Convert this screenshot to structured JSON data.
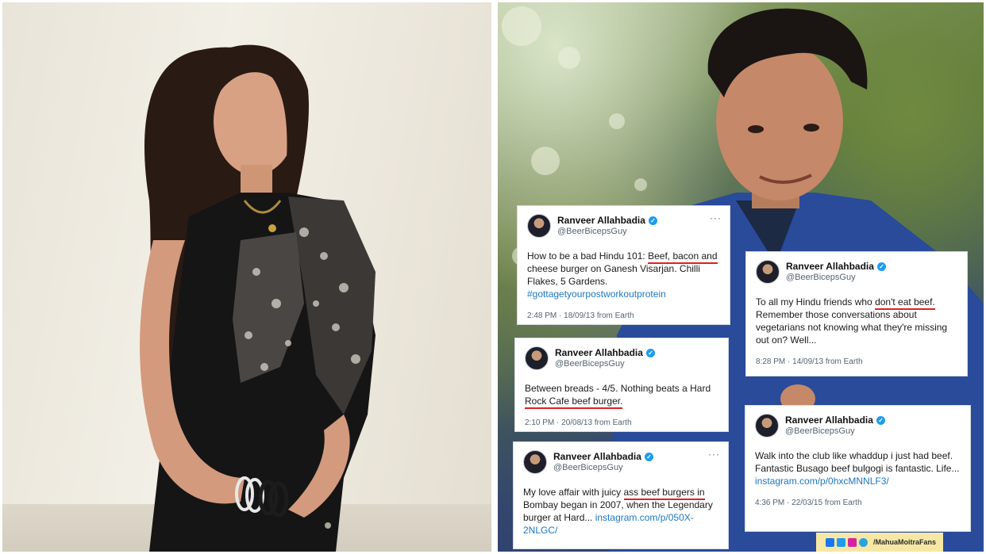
{
  "tweets": [
    {
      "name": "Ranveer Allahbadia",
      "handle": "@BeerBicepsGuy",
      "before": "How to be a bad Hindu 101: ",
      "highlight": "Beef, bacon and",
      "after": " cheese burger on Ganesh Visarjan. Chilli Flakes, 5 Gardens.",
      "hashtag": "#gottagetyourpostworkoutprotein",
      "meta": "2:48 PM · 18/09/13 from Earth"
    },
    {
      "name": "Ranveer Allahbadia",
      "handle": "@BeerBicepsGuy",
      "before": "To all my Hindu friends who ",
      "highlight": "don't eat beef.",
      "after": " Remember those conversations about vegetarians not knowing what they're missing out on? Well...",
      "meta": "8:28 PM · 14/09/13 from Earth"
    },
    {
      "name": "Ranveer Allahbadia",
      "handle": "@BeerBicepsGuy",
      "before": "Between breads - 4/5. Nothing beats a Hard ",
      "highlight": "Rock Cafe beef burger.",
      "after": "",
      "meta": "2:10 PM · 20/08/13 from Earth"
    },
    {
      "name": "Ranveer Allahbadia",
      "handle": "@BeerBicepsGuy",
      "before": "Walk into the club like whaddup i just had beef. Fantastic Busago beef bulgogi is fantastic. Life... ",
      "link": "instagram.com/p/0hxcMNNLF3/",
      "meta": "4:36 PM · 22/03/15 from Earth"
    },
    {
      "name": "Ranveer Allahbadia",
      "handle": "@BeerBicepsGuy",
      "before": "My love affair with juicy ",
      "highlight": "ass beef burgers in",
      "after": " Bombay began in 2007, when the Legendary burger at Hard... ",
      "link": "instagram.com/p/050X-2NLGC/"
    }
  ],
  "watermark": {
    "text": "/MahuaMoitraFans",
    "icons": [
      "facebook-icon",
      "twitter-icon",
      "instagram-icon",
      "telegram-icon"
    ],
    "colors": [
      "#1877f2",
      "#1d9bf0",
      "#d6249f",
      "#2aa3df"
    ]
  },
  "more_glyph": "···",
  "verified_glyph": "✓"
}
